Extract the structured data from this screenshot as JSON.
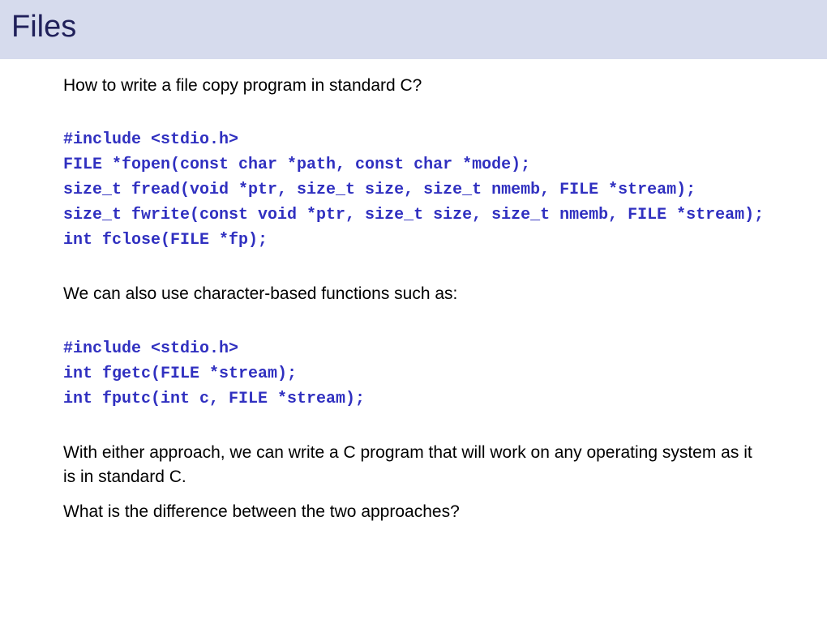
{
  "title": "Files",
  "intro": "How to write a file copy program in standard C?",
  "code1": {
    "line1": "#include <stdio.h>",
    "line2": "FILE *fopen(const char *path, const char *mode);",
    "line3": "size_t fread(void *ptr, size_t size, size_t nmemb, FILE *stream);",
    "line4": "size_t fwrite(const void *ptr, size_t size, size_t nmemb, FILE *stream);",
    "line5": "int fclose(FILE *fp);"
  },
  "middle": "We can also use character-based functions such as:",
  "code2": {
    "line1": "#include <stdio.h>",
    "line2": "int fgetc(FILE *stream);",
    "line3": "int fputc(int c, FILE *stream);"
  },
  "para1": "With either approach, we can write a C program that will work on any operating system as it is in standard C.",
  "para2": "What is the difference between the two approaches?"
}
